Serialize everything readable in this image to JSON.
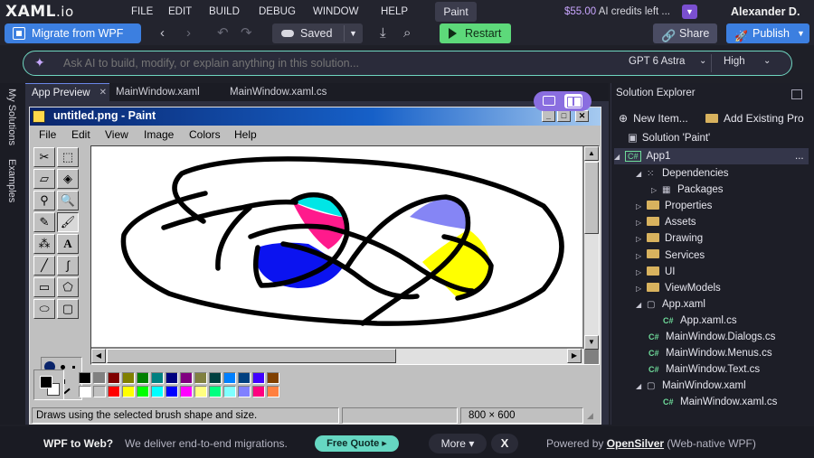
{
  "app": {
    "logo": "XAML",
    "logo_suffix": ".io"
  },
  "menu": {
    "items": [
      "FILE",
      "EDIT",
      "BUILD",
      "DEBUG",
      "WINDOW",
      "HELP"
    ],
    "active": "Paint",
    "credits_amount": "$55.00",
    "credits_text": " AI credits left ...",
    "user": "Alexander D."
  },
  "toolbar": {
    "migrate": "Migrate from WPF",
    "saved": "Saved",
    "restart": "Restart",
    "share": "Share",
    "publish": "Publish"
  },
  "ai": {
    "placeholder": "Ask AI to build, modify, or explain anything in this solution...",
    "model": "GPT 6 Astra",
    "effort": "High"
  },
  "left_rail": {
    "tabs": [
      "My Solutions",
      "Examples"
    ]
  },
  "doc_tabs": [
    "App Preview",
    "MainWindow.xaml",
    "MainWindow.xaml.cs"
  ],
  "paint": {
    "title": "untitled.png - Paint",
    "menus": [
      "File",
      "Edit",
      "View",
      "Image",
      "Colors",
      "Help"
    ],
    "status_text": "Draws using the selected brush shape and size.",
    "status_size": "800 × 600",
    "palette_top": [
      "#000000",
      "#808080",
      "#800000",
      "#808000",
      "#008000",
      "#008080",
      "#000080",
      "#800080",
      "#808040",
      "#004040",
      "#0080ff",
      "#004080",
      "#4000ff",
      "#804000"
    ],
    "palette_bottom": [
      "#ffffff",
      "#c0c0c0",
      "#ff0000",
      "#ffff00",
      "#00ff00",
      "#00ffff",
      "#0000ff",
      "#ff00ff",
      "#ffff80",
      "#00ff80",
      "#80ffff",
      "#8080ff",
      "#ff0080",
      "#ff8040"
    ],
    "primary_color": "#000000",
    "secondary_color": "#ffffff"
  },
  "explorer": {
    "title": "Solution Explorer",
    "new_item": "New Item...",
    "add_existing": "Add Existing Pro",
    "solution": "Solution 'Paint'",
    "project": "App1",
    "project_more": "...",
    "tree": [
      {
        "label": "Dependencies",
        "type": "deps"
      },
      {
        "label": "Packages",
        "type": "pkg"
      },
      {
        "label": "Properties",
        "type": "folder"
      },
      {
        "label": "Assets",
        "type": "folder"
      },
      {
        "label": "Drawing",
        "type": "folder"
      },
      {
        "label": "Services",
        "type": "folder"
      },
      {
        "label": "UI",
        "type": "folder"
      },
      {
        "label": "ViewModels",
        "type": "folder"
      },
      {
        "label": "App.xaml",
        "type": "xaml"
      },
      {
        "label": "App.xaml.cs",
        "type": "cs"
      },
      {
        "label": "MainWindow.Dialogs.cs",
        "type": "cs"
      },
      {
        "label": "MainWindow.Menus.cs",
        "type": "cs"
      },
      {
        "label": "MainWindow.Text.cs",
        "type": "cs"
      },
      {
        "label": "MainWindow.xaml",
        "type": "xaml"
      },
      {
        "label": "MainWindow.xaml.cs",
        "type": "cs"
      }
    ]
  },
  "footer": {
    "lead": "WPF to Web?",
    "text": "We deliver end-to-end migrations.",
    "free_quote": "Free Quote ▸",
    "more": "More ▾",
    "x": "X",
    "powered": "Powered by ",
    "powered_link": "OpenSilver",
    "powered_tail": " (Web-native WPF)"
  }
}
